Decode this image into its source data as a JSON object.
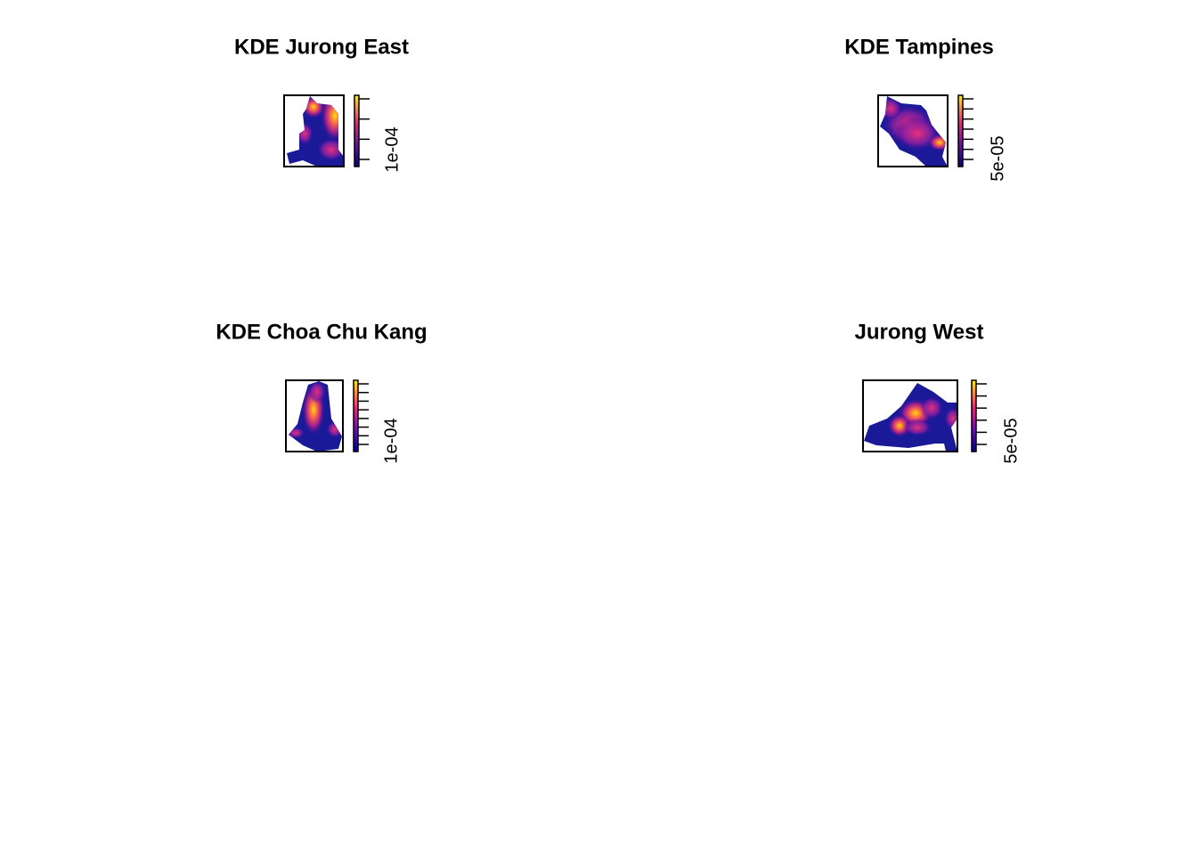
{
  "chart_data": [
    {
      "type": "heatmap",
      "title": "KDE Jurong East",
      "legend_label": "1e-04",
      "legend_ticks": 4,
      "colormap": [
        "#00008B",
        "#8B008B",
        "#FF1493",
        "#FFA500",
        "#FFFF00"
      ]
    },
    {
      "type": "heatmap",
      "title": "KDE Tampines",
      "legend_label": "5e-05",
      "legend_ticks": 7,
      "colormap": [
        "#00008B",
        "#8B008B",
        "#FF1493",
        "#FFA500",
        "#FFFF00"
      ]
    },
    {
      "type": "heatmap",
      "title": "KDE Choa Chu Kang",
      "legend_label": "1e-04",
      "legend_ticks": 8,
      "colormap": [
        "#00008B",
        "#8B008B",
        "#FF1493",
        "#FFA500",
        "#FFFF00"
      ]
    },
    {
      "type": "heatmap",
      "title": "Jurong West",
      "legend_label": "5e-05",
      "legend_ticks": 6,
      "colormap": [
        "#00008B",
        "#8B008B",
        "#FF1493",
        "#FFA500",
        "#FFFF00"
      ]
    }
  ]
}
